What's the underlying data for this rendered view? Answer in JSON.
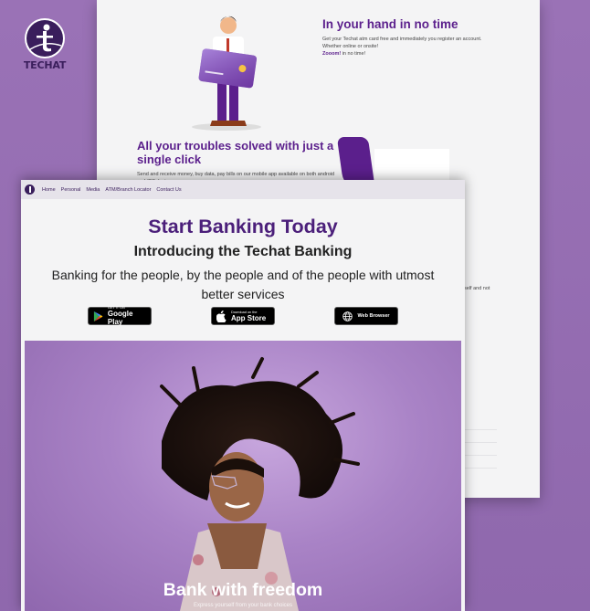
{
  "brand": {
    "name": "TECHAT"
  },
  "back_page": {
    "feature1": {
      "title": "In your hand in no time",
      "line1": "Get your Techat atm card free and immediately you register an account.",
      "line2": "Whether online or onsite!",
      "accent": "Zooom!",
      "tail": " in no time!"
    },
    "feature2": {
      "title": "All your troubles solved with just a single click",
      "text": "Send and receive money, buy data, pay bills on our mobile app available on both android and iOS devices"
    },
    "right_snippet": "self and not"
  },
  "front_page": {
    "nav": [
      "Home",
      "Personal",
      "Media",
      "ATM/Branch Locator",
      "Contact Us"
    ],
    "hero": {
      "title": "Start Banking Today",
      "subtitle": "Introducing the Techat Banking",
      "description": "Banking for the people, by the people and of the people with utmost better services"
    },
    "buttons": {
      "google_play": {
        "small": "GET IT ON",
        "big": "Google Play"
      },
      "app_store": {
        "small": "Download on the",
        "big": "App Store"
      },
      "web_browser": {
        "label": "Web Browser"
      }
    },
    "photo": {
      "caption": "Bank with freedom",
      "subcaption": "Express yourself from your bank choices"
    }
  },
  "colors": {
    "background": "#9a72b6",
    "brand_purple": "#4b1f7a",
    "accent": "#5b1f8c"
  }
}
